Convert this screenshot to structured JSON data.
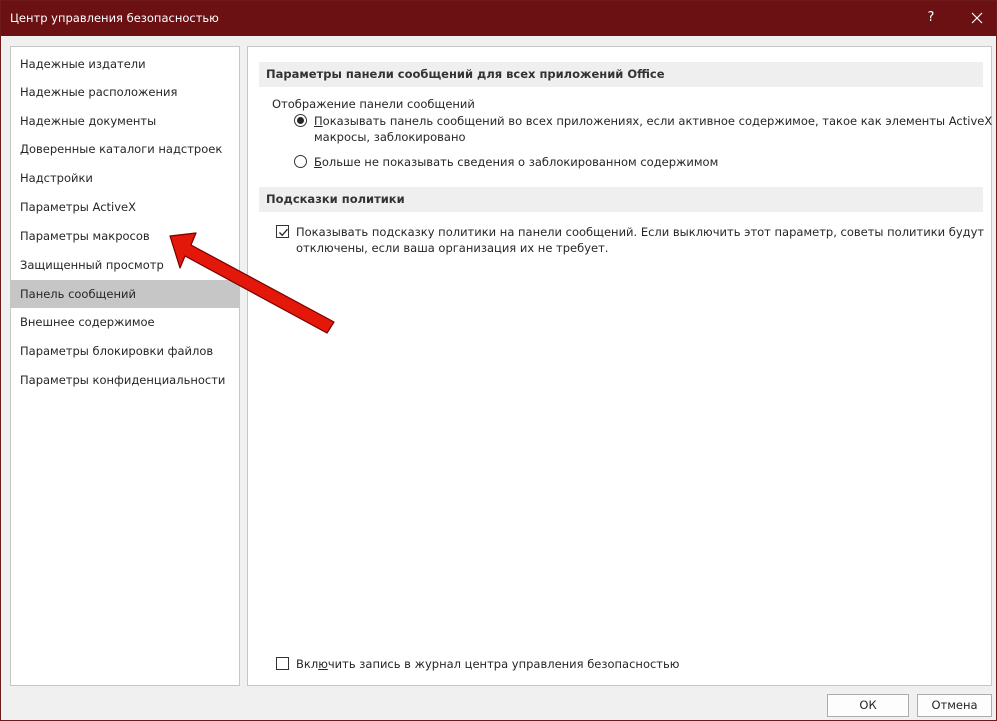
{
  "window": {
    "title": "Центр управления безопасностью",
    "help_label": "?"
  },
  "sidebar": {
    "items": [
      {
        "label": "Надежные издатели",
        "selected": false
      },
      {
        "label": "Надежные расположения",
        "selected": false
      },
      {
        "label": "Надежные документы",
        "selected": false
      },
      {
        "label": "Доверенные каталоги надстроек",
        "selected": false
      },
      {
        "label": "Надстройки",
        "selected": false
      },
      {
        "label": "Параметры ActiveX",
        "selected": false
      },
      {
        "label": "Параметры макросов",
        "selected": false
      },
      {
        "label": "Защищенный просмотр",
        "selected": false
      },
      {
        "label": "Панель сообщений",
        "selected": true
      },
      {
        "label": "Внешнее содержимое",
        "selected": false
      },
      {
        "label": "Параметры блокировки файлов",
        "selected": false
      },
      {
        "label": "Параметры конфиденциальности",
        "selected": false
      }
    ]
  },
  "main": {
    "message_bar_section": {
      "title": "Параметры панели сообщений для всех приложений Office",
      "group_label": "Отображение панели сообщений",
      "option_show": {
        "accel": "П",
        "text_line1_rest": "оказывать панель сообщений во всех приложениях, если активное содержимое, такое как элементы ActiveX и",
        "text_line2": "макросы, заблокировано",
        "selected": true
      },
      "option_hide": {
        "accel": "Б",
        "text_rest": "ольше не показывать сведения о заблокированном содержимом",
        "selected": false
      }
    },
    "policy_section": {
      "title": "Подсказки политики",
      "checkbox": {
        "text_line1": "Показывать подсказку политики на панели сообщений. Если выключить этот параметр, советы политики будут",
        "text_line2": "отключены, если ваша организация их не требует.",
        "checked": true
      }
    },
    "logging": {
      "text_before": "Вкл",
      "accel": "ю",
      "text_after": "чить запись в журнал центра управления безопасностью",
      "checked": false
    }
  },
  "buttons": {
    "ok_label": "ОК",
    "cancel_label": "Отмена"
  },
  "colors": {
    "titlebar": "#6b1114",
    "selection": "#c6c6c6",
    "annotation_arrow": "#e3170a"
  },
  "icons": {
    "close": "close-icon",
    "annotation": "red-arrow-annotation"
  }
}
